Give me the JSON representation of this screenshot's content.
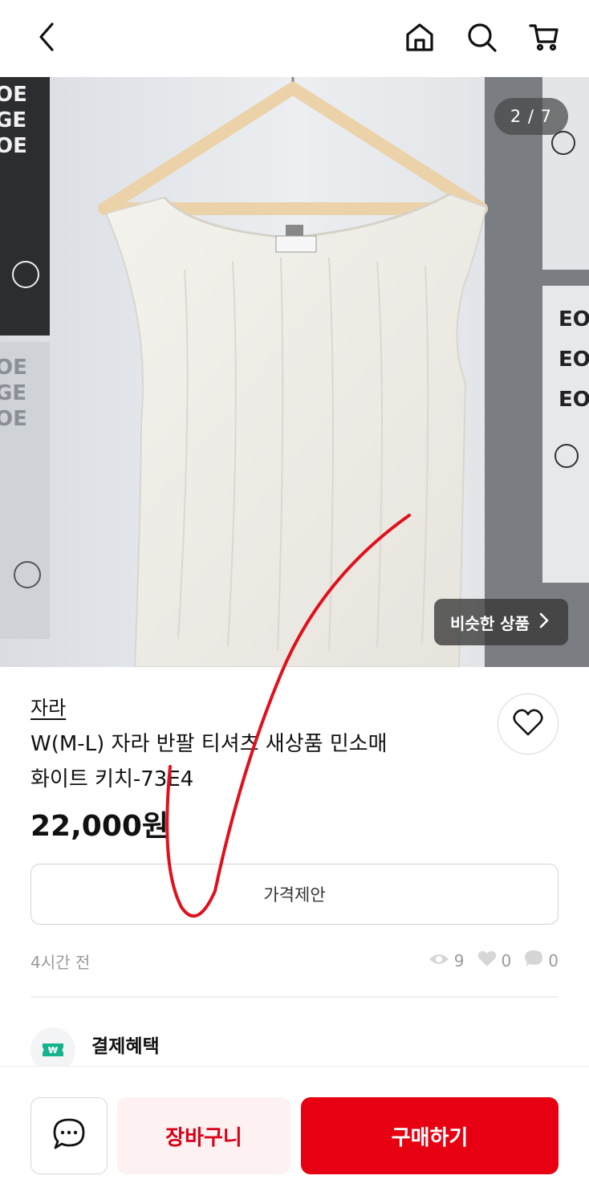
{
  "header": {
    "back_icon": "chevron-left-icon",
    "home_icon": "home-icon",
    "search_icon": "search-icon",
    "cart_icon": "cart-icon"
  },
  "gallery": {
    "counter": "2 / 7",
    "similar_label": "비슷한 상품"
  },
  "product": {
    "brand": "자라",
    "title_line1": "W(M-L) 자라 반팔 티셔츠 새상품 민소매",
    "title_line2": "화이트 키치-73E4",
    "price": "22,000원",
    "offer_label": "가격제안",
    "posted_time": "4시간 전",
    "views": "9",
    "likes": "0",
    "comments": "0"
  },
  "benefit": {
    "label": "결제혜택"
  },
  "actions": {
    "cart_label": "장바구니",
    "buy_label": "구매하기"
  },
  "colors": {
    "accent": "#e60012",
    "cart_bg": "#fdf1f1",
    "cart_text": "#d90017",
    "benefit_icon": "#14b38c"
  }
}
